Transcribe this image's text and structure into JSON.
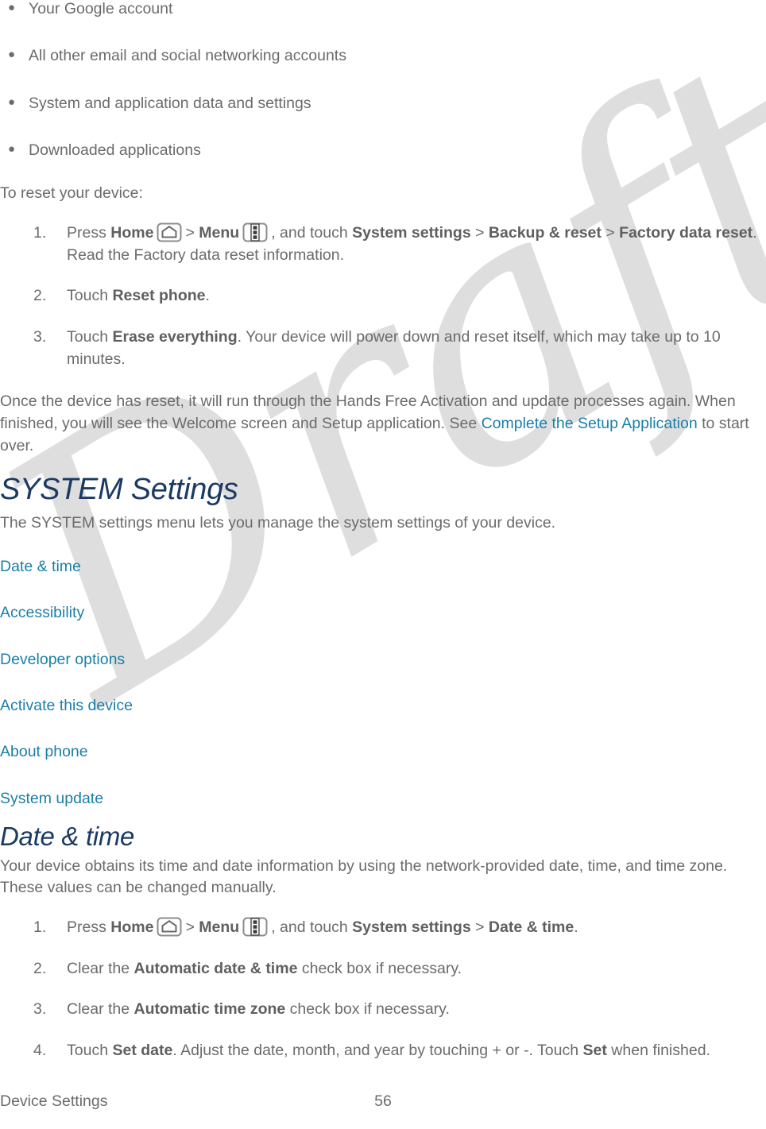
{
  "bullets": [
    "Your Google account",
    "All other email and social networking accounts",
    "System and application data and settings",
    "Downloaded applications"
  ],
  "reset_intro": "To reset your device:",
  "reset_steps": {
    "step1": {
      "marker": "1.",
      "press": "Press",
      "home_label": "Home",
      "home_icon": "home-icon",
      "gt1": ">",
      "menu_label": "Menu",
      "menu_icon": "menu-icon",
      "mid": ", and touch",
      "system_settings": "System settings",
      "gt2": ">",
      "backup_reset": "Backup & reset",
      "gt3": ">",
      "factory_data_reset": "Factory data reset",
      "tail": ". Read the Factory data reset information."
    },
    "step2": {
      "marker": "2.",
      "lead": "Touch",
      "bold": "Reset phone",
      "tail": "."
    },
    "step3": {
      "marker": "3.",
      "lead": "Touch",
      "bold": "Erase everything",
      "tail": ". Your device will power down and reset itself, which may take up to 10 minutes."
    }
  },
  "after_reset": {
    "part1": "Once the device has reset, it will run through the Hands Free Activation and update processes again. When finished, you will see the Welcome screen and Setup application. See ",
    "link": "Complete the Setup Application",
    "part2": " to start over."
  },
  "system_settings_section": {
    "heading": "SYSTEM Settings",
    "intro": "The SYSTEM settings menu lets you manage the system settings of your device.",
    "links": [
      "Date & time",
      "Accessibility",
      "Developer options",
      "Activate this device",
      "About phone",
      "System update"
    ]
  },
  "date_time_section": {
    "heading": "Date & time",
    "intro": "Your device obtains its time and date information by using the network-provided date, time, and time zone. These values can be changed manually.",
    "steps": {
      "step1": {
        "marker": "1.",
        "press": "Press",
        "home_label": "Home",
        "home_icon": "home-icon",
        "gt1": ">",
        "menu_label": "Menu",
        "menu_icon": "menu-icon",
        "mid": ", and touch",
        "system_settings": "System settings",
        "gt2": ">",
        "date_time": "Date & time",
        "tail": "."
      },
      "step2": {
        "marker": "2.",
        "lead": "Clear the",
        "bold": "Automatic date & time",
        "tail": "check box if necessary."
      },
      "step3": {
        "marker": "3.",
        "lead": "Clear the",
        "bold": "Automatic time zone",
        "tail": "check box if necessary."
      },
      "step4": {
        "marker": "4.",
        "lead": "Touch",
        "bold1": "Set date",
        "mid": ". Adjust the date, month, and year by touching + or -. Touch",
        "bold2": "Set",
        "tail": "when finished."
      }
    }
  },
  "watermark": {
    "text": "Draft"
  },
  "footer": {
    "section": "Device Settings",
    "page_number": "56"
  },
  "colors": {
    "body_text": "#6b6b6b",
    "heading": "#1b3a63",
    "link": "#1a7fa8",
    "watermark": "#dedede"
  }
}
